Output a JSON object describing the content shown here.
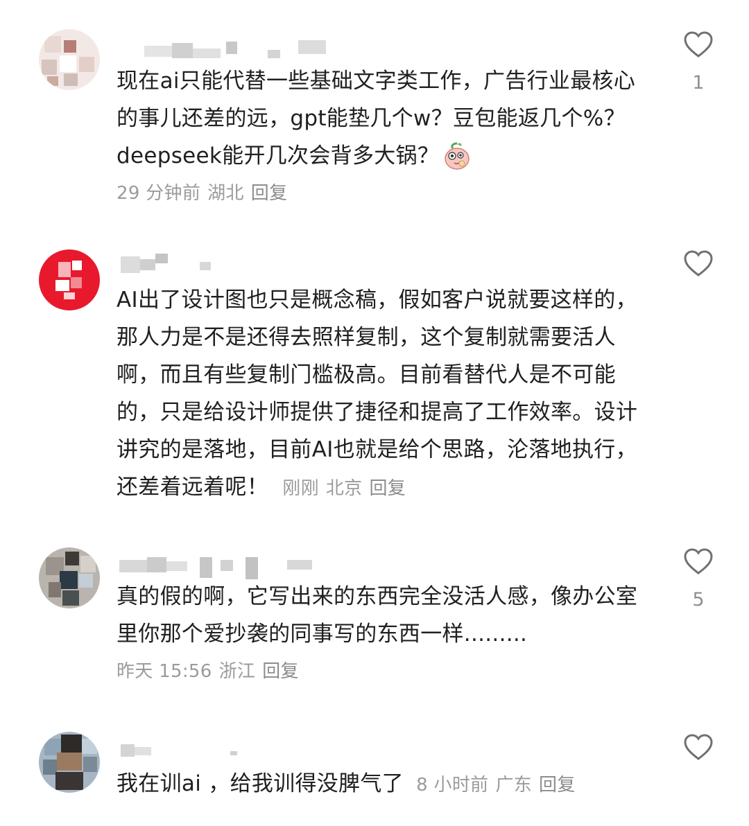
{
  "comments": [
    {
      "text": "现在ai只能代替一些基础文字类工作，广告行业最核心的事儿还差的远，gpt能垫几个w？豆包能返几个%？deepseek能开几次会背多大锅？",
      "emoji": "peach-face-emoji",
      "time": "29 分钟前",
      "location": "湖北",
      "reply_label": "回复",
      "likes": "1"
    },
    {
      "text": "AI出了设计图也只是概念稿，假如客户说就要这样的，那人力是不是还得去照样复制，这个复制就需要活人啊，而且有些复制门槛极高。目前看替代人是不可能的，只是给设计师提供了捷径和提高了工作效率。设计讲究的是落地，目前AI也就是给个思路，沦落地执行，还差着远着呢！",
      "time": "刚刚",
      "location": "北京",
      "reply_label": "回复",
      "likes": ""
    },
    {
      "text": "真的假的啊，它写出来的东西完全没活人感，像办公室里你那个爱抄袭的同事写的东西一样.........",
      "time": "昨天 15:56",
      "location": "浙江",
      "reply_label": "回复",
      "likes": "5"
    },
    {
      "text": "我在训ai ，给我训得没脾气了",
      "time": "8 小时前",
      "location": "广东",
      "reply_label": "回复",
      "likes": ""
    }
  ],
  "colors": {
    "text": "#202020",
    "meta": "#9b9b9b",
    "heart_stroke": "#707070",
    "avatar2_red": "#e8192c"
  },
  "icons": {
    "like": "heart-outline-icon"
  }
}
